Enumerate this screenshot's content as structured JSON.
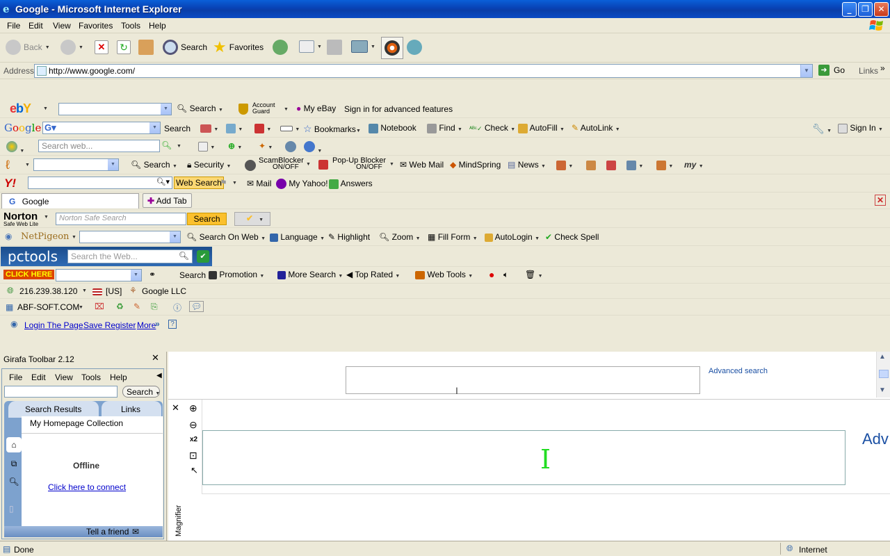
{
  "window": {
    "title": "Google - Microsoft Internet Explorer"
  },
  "menu": [
    "File",
    "Edit",
    "View",
    "Favorites",
    "Tools",
    "Help"
  ],
  "std": {
    "back": "Back",
    "search": "Search",
    "favorites": "Favorites"
  },
  "address": {
    "label": "Address",
    "url": "http://www.google.com/",
    "go": "Go",
    "links": "Links"
  },
  "ebay": {
    "logo": "ebY",
    "search": "Search",
    "account_guard_1": "Account",
    "account_guard_2": "Guard",
    "my_ebay": "My eBay",
    "signin": "Sign in for advanced features"
  },
  "google": {
    "logo": "Google",
    "search": "Search",
    "bookmarks": "Bookmarks",
    "notebook": "Notebook",
    "find": "Find",
    "check": "Check",
    "autofill": "AutoFill",
    "autolink": "AutoLink",
    "signin": "Sign In"
  },
  "msn": {
    "placeholder": "Search web..."
  },
  "earthlink": {
    "search": "Search",
    "security": "Security",
    "scam_1": "ScamBlocker",
    "scam_2": "ON/OFF",
    "popup_1": "Pop-Up Blocker",
    "popup_2": "ON/OFF",
    "webmail": "Web Mail",
    "mindspring": "MindSpring",
    "news": "News"
  },
  "yahoo": {
    "logo": "Y!",
    "websearch": "Web Search",
    "mail": "Mail",
    "myyahoo": "My Yahoo!",
    "answers": "Answers"
  },
  "tabs": {
    "tab1": "Google",
    "add": "Add Tab"
  },
  "norton": {
    "logo": "Norton",
    "sub": "Safe Web Lite",
    "placeholder": "Norton Safe Search",
    "search": "Search"
  },
  "netpigeon": {
    "logo": "NetPigeon",
    "search_on_web": "Search On Web",
    "language": "Language",
    "highlight": "Highlight",
    "zoom": "Zoom",
    "fill_form": "Fill Form",
    "autologin": "AutoLogin",
    "check_spell": "Check Spell"
  },
  "pctools": {
    "logo": "pctools",
    "placeholder": "Search the Web..."
  },
  "clickhere": {
    "badge": "CLICK HERE",
    "search": "Search",
    "promotion": "Promotion",
    "more_search": "More Search",
    "top_rated": "Top Rated",
    "web_tools": "Web Tools"
  },
  "ip": {
    "address": "216.239.38.120",
    "country": "[US]",
    "org": "Google LLC"
  },
  "abf": {
    "name": "ABF-SOFT.COM"
  },
  "login": {
    "login": "Login The Page",
    "save": "Save Register",
    "more": "More"
  },
  "girafa": {
    "title": "Girafa Toolbar 2.12",
    "menu": [
      "File",
      "Edit",
      "View",
      "Tools",
      "Help"
    ],
    "search": "Search",
    "tab_results": "Search Results",
    "tab_links": "Links",
    "collection": "My Homepage Collection",
    "offline": "Offline",
    "connect": "Click here to connect",
    "tell": "Tell a friend"
  },
  "page": {
    "advanced": "Advanced search",
    "magnifier": "Magnifier",
    "x2": "x2",
    "adv_zoomed": "Adv"
  },
  "status": {
    "done": "Done",
    "zone": "Internet"
  }
}
